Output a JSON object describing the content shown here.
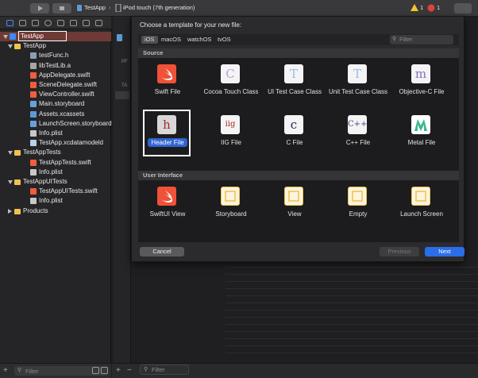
{
  "toolbar": {
    "scheme_target": "TestApp",
    "scheme_device": "iPod touch (7th generation)",
    "warning_count": "1",
    "error_count": "1"
  },
  "navigator": {
    "rows": [
      {
        "label": "TestApp",
        "indent": 0,
        "kind": "proj",
        "disclosure": true
      },
      {
        "label": "TestApp",
        "indent": 1,
        "kind": "folder",
        "disclosure": true
      },
      {
        "label": "testFunc.h",
        "indent": 2,
        "kind": "hfile"
      },
      {
        "label": "libTestLib.a",
        "indent": 2,
        "kind": "lib"
      },
      {
        "label": "AppDelegate.swift",
        "indent": 2,
        "kind": "swift"
      },
      {
        "label": "SceneDelegate.swift",
        "indent": 2,
        "kind": "swift"
      },
      {
        "label": "ViewController.swift",
        "indent": 2,
        "kind": "swift"
      },
      {
        "label": "Main.storyboard",
        "indent": 2,
        "kind": "sb"
      },
      {
        "label": "Assets.xcassets",
        "indent": 2,
        "kind": "assets"
      },
      {
        "label": "LaunchScreen.storyboard",
        "indent": 2,
        "kind": "sb"
      },
      {
        "label": "Info.plist",
        "indent": 2,
        "kind": "plist"
      },
      {
        "label": "TestApp.xcdatamodeld",
        "indent": 2,
        "kind": "model"
      },
      {
        "label": "TestAppTests",
        "indent": 1,
        "kind": "folder",
        "disclosure": true
      },
      {
        "label": "TestAppTests.swift",
        "indent": 2,
        "kind": "swift"
      },
      {
        "label": "Info.plist",
        "indent": 2,
        "kind": "plist"
      },
      {
        "label": "TestAppUITests",
        "indent": 1,
        "kind": "folder",
        "disclosure": true
      },
      {
        "label": "TestAppUITests.swift",
        "indent": 2,
        "kind": "swift"
      },
      {
        "label": "Info.plist",
        "indent": 2,
        "kind": "plist"
      },
      {
        "label": "Products",
        "indent": 1,
        "kind": "folder",
        "disclosure": "collapsed"
      }
    ],
    "filter_placeholder": "Filter"
  },
  "editor": {
    "side_labels": [
      "PF",
      "TA"
    ],
    "filter_placeholder": "Filter"
  },
  "sheet": {
    "title": "Choose a template for your new file:",
    "tabs": [
      "iOS",
      "macOS",
      "watchOS",
      "tvOS"
    ],
    "selected_tab": "iOS",
    "filter_placeholder": "Filter",
    "source_header": "Source",
    "source_templates": [
      {
        "label": "Swift File",
        "icon": "swift-icon",
        "glyph": "",
        "color": "#f05138"
      },
      {
        "label": "Cocoa Touch Class",
        "icon": "cocoa-touch-class-icon",
        "glyph": "C",
        "color": "#b9a0d8"
      },
      {
        "label": "UI Test Case Class",
        "icon": "ui-test-case-icon",
        "glyph": "T",
        "color": "#9bbbe0"
      },
      {
        "label": "Unit Test Case Class",
        "icon": "unit-test-case-icon",
        "glyph": "T",
        "color": "#9bbbe0"
      },
      {
        "label": "Objective-C File",
        "icon": "objc-file-icon",
        "glyph": "m",
        "color": "#8a6fc0"
      },
      {
        "label": "Header File",
        "icon": "header-file-icon",
        "glyph": "h",
        "color": "#a52a2a"
      },
      {
        "label": "IIG File",
        "icon": "iig-file-icon",
        "glyph": "iig",
        "color": "#a52a2a"
      },
      {
        "label": "C File",
        "icon": "c-file-icon",
        "glyph": "c",
        "color": "#1f1f5e"
      },
      {
        "label": "C++ File",
        "icon": "cpp-file-icon",
        "glyph": "C++",
        "color": "#5a3d8a"
      },
      {
        "label": "Metal File",
        "icon": "metal-file-icon",
        "glyph": "",
        "color": "#3cb88e"
      }
    ],
    "selected_template": "Header File",
    "ui_header": "User Interface",
    "ui_templates": [
      {
        "label": "SwiftUI View",
        "icon": "swift-icon"
      },
      {
        "label": "Storyboard",
        "icon": "storyboard-icon"
      },
      {
        "label": "View",
        "icon": "view-icon"
      },
      {
        "label": "Empty",
        "icon": "empty-icon"
      },
      {
        "label": "Launch Screen",
        "icon": "launch-screen-icon"
      }
    ],
    "cancel_label": "Cancel",
    "previous_label": "Previous",
    "next_label": "Next"
  },
  "colors": {
    "accent": "#2f63d1",
    "next_button": "#2a6ee8"
  }
}
